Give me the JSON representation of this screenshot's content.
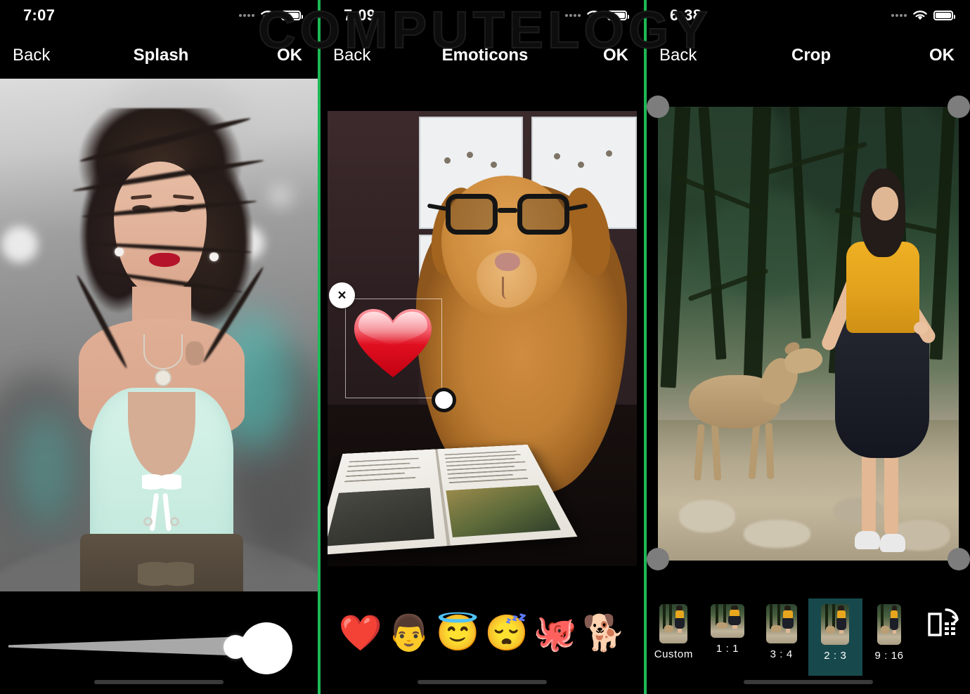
{
  "watermark": {
    "text": "COMPUTELOGY"
  },
  "panels": [
    {
      "id": "splash",
      "status": {
        "time": "7:07",
        "signal_icon": "signal-dots-icon",
        "wifi_icon": "wifi-icon",
        "battery_icon": "battery-icon"
      },
      "nav": {
        "back": "Back",
        "title": "Splash",
        "ok": "OK"
      },
      "controls": {
        "slider_name": "brush-size-slider",
        "preview_name": "brush-size-preview",
        "slider_value": 90
      }
    },
    {
      "id": "emoticons",
      "status": {
        "time": "7:09",
        "signal_icon": "signal-dots-icon",
        "wifi_icon": "wifi-icon",
        "battery_icon": "battery-icon"
      },
      "nav": {
        "back": "Back",
        "title": "Emoticons",
        "ok": "OK"
      },
      "sticker": {
        "selected_emoji": "❤️",
        "close_label": "×",
        "close_name": "sticker-close-icon",
        "resize_name": "sticker-resize-handle"
      },
      "emoji_tray": [
        {
          "glyph": "❤️",
          "name": "emoji-red-heart"
        },
        {
          "glyph": "👨",
          "name": "emoji-man"
        },
        {
          "glyph": "😇",
          "name": "emoji-smiling-face-with-halo"
        },
        {
          "glyph": "😴",
          "name": "emoji-sleeping-face"
        },
        {
          "glyph": "🐙",
          "name": "emoji-octopus"
        },
        {
          "glyph": "🐕",
          "name": "emoji-dog"
        }
      ]
    },
    {
      "id": "crop",
      "status": {
        "time": "6:38",
        "signal_icon": "signal-dots-icon",
        "wifi_icon": "wifi-icon",
        "battery_icon": "battery-icon"
      },
      "nav": {
        "back": "Back",
        "title": "Crop",
        "ok": "OK"
      },
      "crop_handles": [
        "top-left",
        "top-right",
        "bottom-left",
        "bottom-right"
      ],
      "ratios": [
        {
          "label": "Custom",
          "selected": false
        },
        {
          "label": "1 : 1",
          "selected": false
        },
        {
          "label": "3 : 4",
          "selected": false
        },
        {
          "label": "2 : 3",
          "selected": true
        },
        {
          "label": "9 : 16",
          "selected": false
        }
      ],
      "rotate_icon": "rotate-flip-icon",
      "selected_ratio": "2 : 3",
      "accent_color": "#17494c"
    }
  ],
  "theme": {
    "background": "#000000",
    "separator_color": "#1fb855",
    "text_color": "#ffffff",
    "selected_ratio_bg": "#17494c"
  }
}
